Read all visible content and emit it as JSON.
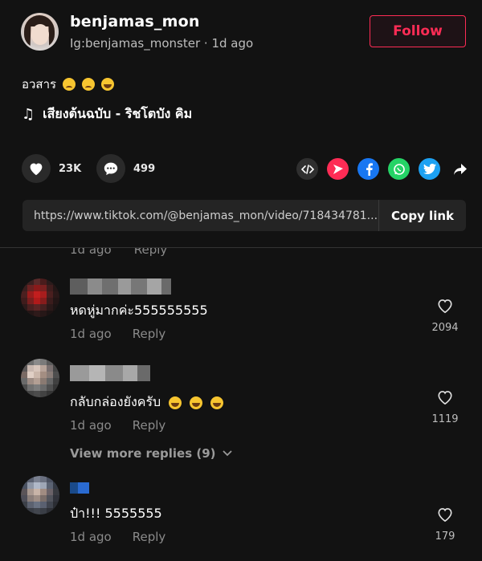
{
  "post": {
    "username": "benjamas_mon",
    "subline_handle": "Ig:benjamas_monster",
    "subline_sep": " · ",
    "subline_time": "1d ago",
    "follow_label": "Follow",
    "caption_text": "อวสาร",
    "caption_emojis": [
      "sad-face-emoji",
      "sad-face-emoji",
      "laughing-tears-emoji"
    ],
    "music_icon": "music-note-icon",
    "music_title": "เสียงต้นฉบับ - ริชโตบัง คิม"
  },
  "stats": {
    "likes": "23K",
    "comments": "499"
  },
  "share": {
    "icons": [
      "embed-icon",
      "send-icon",
      "facebook-icon",
      "whatsapp-icon",
      "twitter-icon",
      "share-arrow-icon"
    ],
    "colors": {
      "embed": "#2f2f2f",
      "send": "#fe2c55",
      "facebook": "#1877f2",
      "whatsapp": "#25d366",
      "twitter": "#1da1f2"
    }
  },
  "link": {
    "url": "https://www.tiktok.com/@benjamas_mon/video/718434781...",
    "copy_label": "Copy link"
  },
  "partial_row": {
    "time": "1d ago",
    "reply": "Reply"
  },
  "comments": [
    {
      "text": "หดหู่มากค่ะ555555555",
      "time": "1d ago",
      "reply": "Reply",
      "likes": "2094",
      "emojis": []
    },
    {
      "text": "กลับกล่องยังครับ",
      "time": "1d ago",
      "reply": "Reply",
      "likes": "1119",
      "emojis": [
        "laughing-tears-emoji",
        "laughing-tears-emoji",
        "laughing-tears-emoji"
      ]
    },
    {
      "text": "ป๋า!!! 5555555",
      "time": "1d ago",
      "reply": "Reply",
      "likes": "179",
      "emojis": []
    }
  ],
  "view_more": {
    "label": "View more replies (9)"
  },
  "colors": {
    "background": "#121212",
    "accent": "#fe2c55",
    "muted_text": "#8a8a8a"
  }
}
